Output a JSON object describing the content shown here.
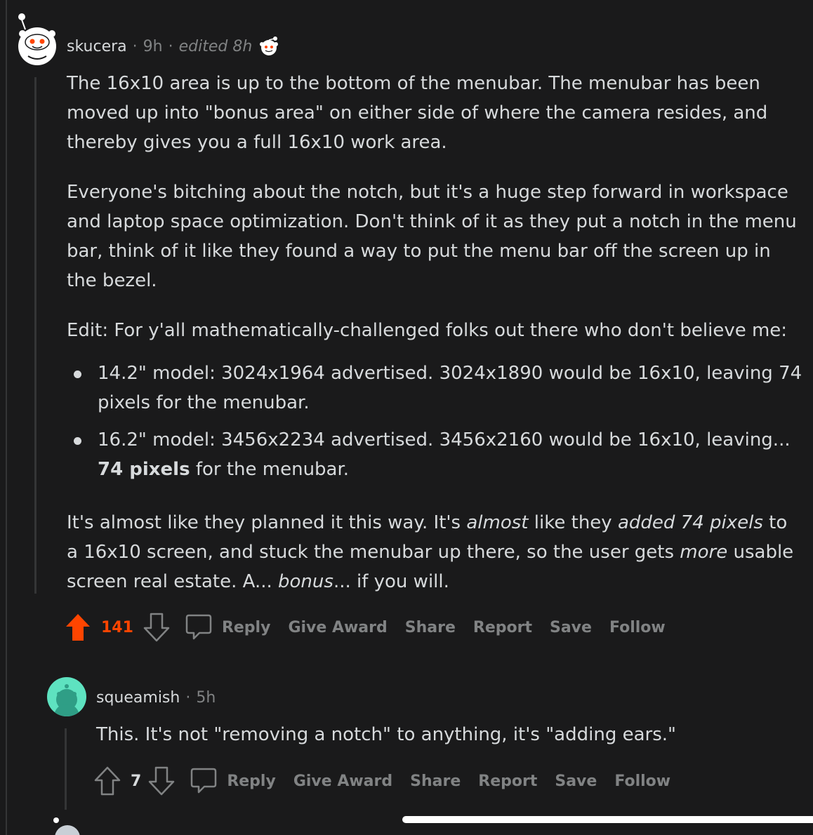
{
  "comment": {
    "author": "skucera",
    "sep1": "·",
    "age": "9h",
    "sep2": "·",
    "edited": "edited 8h",
    "para1": "The 16x10 area is up to the bottom of the menubar. The menubar has been moved up into \"bonus area\" on either side of where the camera resides, and thereby gives you a full 16x10 work area.",
    "para2": "Everyone's bitching about the notch, but it's a huge step forward in workspace and laptop space optimization. Don't think of it as they put a notch in the menu bar, think of it like they found a way to put the menu bar off the screen up in the bezel.",
    "para3": "Edit: For y'all mathematically-challenged folks out there who don't believe me:",
    "bullet1": "14.2\" model: 3024x1964 advertised. 3024x1890 would be 16x10, leaving 74 pixels for the menubar.",
    "bullet2_a": "16.2\" model: 3456x2234 advertised. 3456x2160 would be 16x10, leaving...",
    "bullet2_bold": "74 pixels",
    "bullet2_b": " for the menubar.",
    "p4_a": "It's almost like they planned it this way. It's ",
    "p4_i1": "almost",
    "p4_b": " like they ",
    "p4_i2": "added 74 pixels",
    "p4_c": " to a 16x10 screen, and stuck the menubar up there, so the user gets ",
    "p4_i3": "more",
    "p4_d": " usable screen real estate. A... ",
    "p4_i4": "bonus",
    "p4_e": "... if you will.",
    "score": "141",
    "actions": {
      "reply": "Reply",
      "give_award": "Give Award",
      "share": "Share",
      "report": "Report",
      "save": "Save",
      "follow": "Follow"
    }
  },
  "reply": {
    "author": "squeamish",
    "sep": "·",
    "age": "5h",
    "text": "This. It's not \"removing a notch\" to anything, it's \"adding ears.\"",
    "score": "7",
    "actions": {
      "reply": "Reply",
      "give_award": "Give Award",
      "share": "Share",
      "report": "Report",
      "save": "Save",
      "follow": "Follow"
    }
  },
  "colors": {
    "background": "#1a1a1b",
    "text": "#d7dadc",
    "muted": "#818384",
    "upvoted": "#ff4500",
    "snoo_avatar_bg": "#ffffff",
    "reply_avatar_bg": "#5ee2c0"
  },
  "icons": [
    "snoo-avatar-icon",
    "award-snoo-icon",
    "upvote-arrow-icon",
    "downvote-arrow-icon",
    "comment-bubble-icon"
  ]
}
